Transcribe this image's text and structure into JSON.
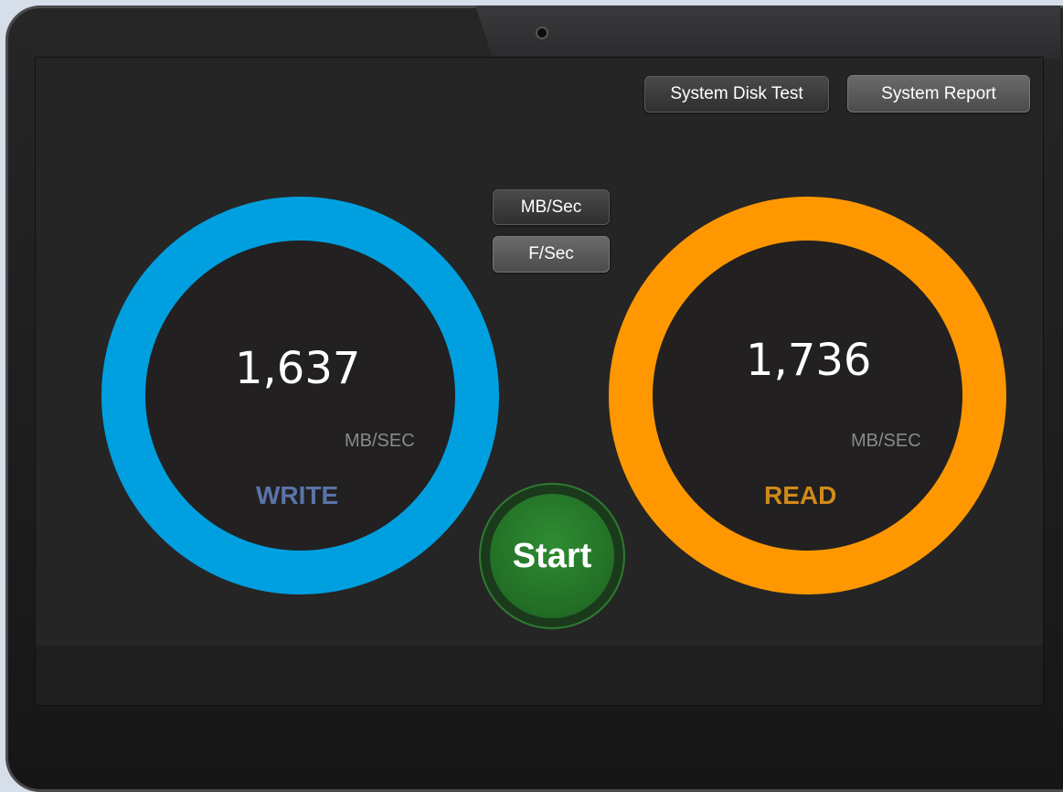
{
  "toolbar": {
    "disk_test_label": "System Disk Test",
    "report_label": "System Report"
  },
  "units": {
    "mb_sec_label": "MB/Sec",
    "f_sec_label": "F/Sec"
  },
  "write": {
    "value": "1,637",
    "unit": "MB/SEC",
    "label": "WRITE",
    "ring_color": "#00a0e0",
    "label_color": "#5a74a8"
  },
  "read": {
    "value": "1,736",
    "unit": "MB/SEC",
    "label": "READ",
    "ring_color": "#ff9800",
    "label_color": "#d18a1a"
  },
  "start_label": "Start",
  "start_color": "#2a7a2d"
}
